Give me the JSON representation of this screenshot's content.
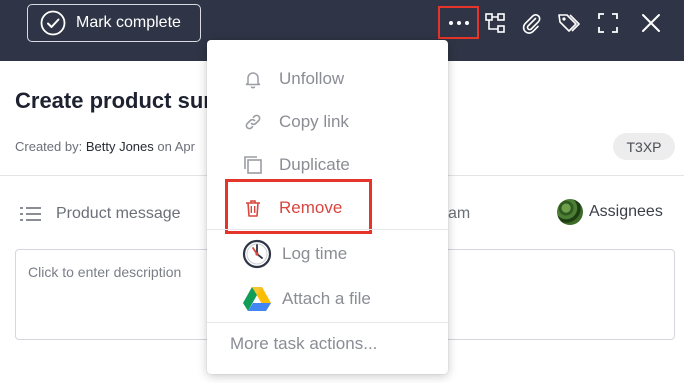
{
  "toolbar": {
    "mark_complete_label": "Mark complete",
    "icons": [
      "check-circle-icon",
      "more-icon",
      "subtasks-icon",
      "attachment-icon",
      "tags-icon",
      "fullscreen-icon",
      "close-icon"
    ]
  },
  "task": {
    "title": "Create product sum",
    "created_prefix": "Created by:",
    "created_by": "Betty Jones",
    "created_on": "on Apr",
    "tag": "T3XP"
  },
  "fields": {
    "product_label": "Product message",
    "team_label": "am",
    "assignees_label": "Assignees"
  },
  "description": {
    "placeholder": "Click to enter description"
  },
  "menu": {
    "items": [
      {
        "label": "Unfollow",
        "icon": "bell-icon"
      },
      {
        "label": "Copy link",
        "icon": "link-icon"
      },
      {
        "label": "Duplicate",
        "icon": "duplicate-icon"
      },
      {
        "label": "Remove",
        "icon": "trash-icon"
      },
      {
        "label": "Log time",
        "icon": "clock-icon"
      },
      {
        "label": "Attach a file",
        "icon": "google-drive-icon"
      }
    ],
    "more_actions": "More task actions..."
  },
  "colors": {
    "topbar": "#2f3546",
    "highlight": "#e5352a",
    "remove_text": "#d8473f"
  }
}
